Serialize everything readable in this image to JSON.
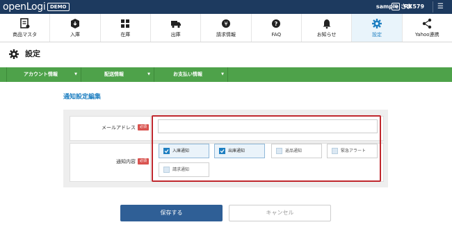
{
  "header": {
    "logo": "openLogi",
    "badge": "DEMO",
    "user": "sample さま",
    "id_tag": "ID",
    "id_value": "RX579"
  },
  "nav": [
    {
      "label": "商品マスタ",
      "icon": "product-list-icon"
    },
    {
      "label": "入庫",
      "icon": "inbound-box-icon"
    },
    {
      "label": "在庫",
      "icon": "inventory-grid-icon"
    },
    {
      "label": "出庫",
      "icon": "truck-icon"
    },
    {
      "label": "請求情報",
      "icon": "billing-coin-icon"
    },
    {
      "label": "FAQ",
      "icon": "question-icon"
    },
    {
      "label": "お知らせ",
      "icon": "bell-icon"
    },
    {
      "label": "設定",
      "icon": "gear-icon",
      "active": true
    },
    {
      "label": "Yahoo連携",
      "icon": "share-icon"
    }
  ],
  "page": {
    "title": "設定"
  },
  "subnav": [
    {
      "label": "アカウント情報"
    },
    {
      "label": "配送情報"
    },
    {
      "label": "お支払い情報"
    }
  ],
  "form": {
    "section_title": "通知設定編集",
    "email_label": "メールアドレス",
    "required": "必須",
    "email_value": "",
    "notify_label": "通知内容",
    "options": [
      {
        "label": "入庫通知",
        "checked": true
      },
      {
        "label": "出庫通知",
        "checked": true
      },
      {
        "label": "返品通知",
        "checked": false
      },
      {
        "label": "緊急アラート",
        "checked": false
      },
      {
        "label": "請求通知",
        "checked": false
      }
    ]
  },
  "buttons": {
    "save": "保存する",
    "cancel": "キャンセル"
  },
  "colors": {
    "header": "#1d3a5f",
    "green": "#4ea24a",
    "accent": "#1e7fc1",
    "highlight": "#c0272d"
  }
}
